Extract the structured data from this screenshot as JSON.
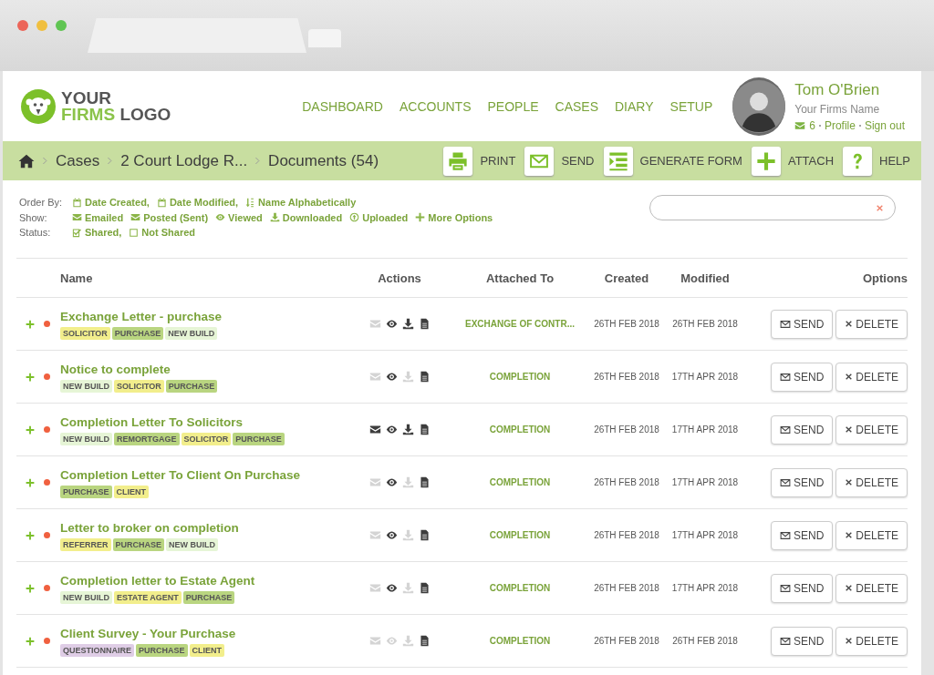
{
  "logo": {
    "words": [
      {
        "text": "YOUR",
        "accent": false
      },
      {
        "text": "FIRMS",
        "accent": true
      },
      {
        "text": "LOGO",
        "accent": false
      }
    ]
  },
  "nav": [
    "DASHBOARD",
    "ACCOUNTS",
    "PEOPLE",
    "CASES",
    "DIARY",
    "SETUP"
  ],
  "user": {
    "name": "Tom O'Brien",
    "firm": "Your Firms Name",
    "messages": "6",
    "links": [
      "Profile",
      "Sign out"
    ]
  },
  "breadcrumb": [
    "Cases",
    "2 Court Lodge R...",
    "Documents (54)"
  ],
  "toolbar": [
    "PRINT",
    "SEND",
    "GENERATE FORM",
    "ATTACH",
    "HELP"
  ],
  "filters": {
    "order_by": {
      "label": "Order By:",
      "items": [
        "Date Created,",
        "Date Modified,",
        "Name Alphabetically"
      ]
    },
    "show": {
      "label": "Show:",
      "items": [
        "Emailed",
        "Posted (Sent)",
        "Viewed",
        "Downloaded",
        "Uploaded",
        "More Options"
      ]
    },
    "status": {
      "label": "Status:",
      "items": [
        {
          "text": "Shared,",
          "checked": true
        },
        {
          "text": "Not Shared",
          "checked": false
        }
      ]
    }
  },
  "table": {
    "columns": [
      "Name",
      "Actions",
      "Attached To",
      "Created",
      "Modified",
      "Options"
    ],
    "rows": [
      {
        "name": "Exchange Letter - purchase",
        "tags": [
          {
            "text": "SOLICITOR",
            "color": "#f2ee8c"
          },
          {
            "text": "PURCHASE",
            "color": "#b9d580"
          },
          {
            "text": "NEW BUILD",
            "color": "#e6f5d6"
          }
        ],
        "emailed": false,
        "viewed": true,
        "downloaded": true,
        "attached_to": "EXCHANGE OF CONTR...",
        "created": "26TH FEB 2018",
        "modified": "26TH FEB 2018",
        "buttons": [
          "SEND",
          "DELETE"
        ]
      },
      {
        "name": "Notice to complete",
        "tags": [
          {
            "text": "NEW BUILD",
            "color": "#e6f5d6"
          },
          {
            "text": "SOLICITOR",
            "color": "#f2ee8c"
          },
          {
            "text": "PURCHASE",
            "color": "#b9d580"
          }
        ],
        "emailed": false,
        "viewed": true,
        "downloaded": false,
        "attached_to": "COMPLETION",
        "created": "26TH FEB 2018",
        "modified": "17TH APR 2018",
        "buttons": [
          "SEND",
          "DELETE"
        ]
      },
      {
        "name": "Completion Letter To Solicitors",
        "tags": [
          {
            "text": "NEW BUILD",
            "color": "#e6f5d6"
          },
          {
            "text": "REMORTGAGE",
            "color": "#b9d580"
          },
          {
            "text": "SOLICITOR",
            "color": "#f2ee8c"
          },
          {
            "text": "PURCHASE",
            "color": "#b9d580"
          }
        ],
        "emailed": true,
        "viewed": true,
        "downloaded": true,
        "attached_to": "COMPLETION",
        "created": "26TH FEB 2018",
        "modified": "17TH APR 2018",
        "buttons": [
          "SEND",
          "DELETE"
        ]
      },
      {
        "name": "Completion Letter To Client On Purchase",
        "tags": [
          {
            "text": "PURCHASE",
            "color": "#b9d580"
          },
          {
            "text": "CLIENT",
            "color": "#f2ee8c"
          }
        ],
        "emailed": false,
        "viewed": true,
        "downloaded": false,
        "attached_to": "COMPLETION",
        "created": "26TH FEB 2018",
        "modified": "17TH APR 2018",
        "buttons": [
          "SEND",
          "DELETE"
        ]
      },
      {
        "name": "Letter to broker on completion",
        "tags": [
          {
            "text": "REFERRER",
            "color": "#f2ee8c"
          },
          {
            "text": "PURCHASE",
            "color": "#b9d580"
          },
          {
            "text": "NEW BUILD",
            "color": "#e6f5d6"
          }
        ],
        "emailed": false,
        "viewed": true,
        "downloaded": false,
        "attached_to": "COMPLETION",
        "created": "26TH FEB 2018",
        "modified": "17TH APR 2018",
        "buttons": [
          "SEND",
          "DELETE"
        ]
      },
      {
        "name": "Completion letter to Estate Agent",
        "tags": [
          {
            "text": "NEW BUILD",
            "color": "#e6f5d6"
          },
          {
            "text": "ESTATE AGENT",
            "color": "#f2ee8c"
          },
          {
            "text": "PURCHASE",
            "color": "#b9d580"
          }
        ],
        "emailed": false,
        "viewed": true,
        "downloaded": false,
        "attached_to": "COMPLETION",
        "created": "26TH FEB 2018",
        "modified": "17TH APR 2018",
        "buttons": [
          "SEND",
          "DELETE"
        ]
      },
      {
        "name": "Client Survey - Your Purchase",
        "tags": [
          {
            "text": "QUESTIONNAIRE",
            "color": "#dfcde6"
          },
          {
            "text": "PURCHASE",
            "color": "#b9d580"
          },
          {
            "text": "CLIENT",
            "color": "#f2ee8c"
          }
        ],
        "emailed": false,
        "viewed": false,
        "downloaded": false,
        "attached_to": "COMPLETION",
        "created": "26TH FEB 2018",
        "modified": "26TH FEB 2018",
        "buttons": [
          "SEND",
          "DELETE"
        ]
      }
    ]
  }
}
